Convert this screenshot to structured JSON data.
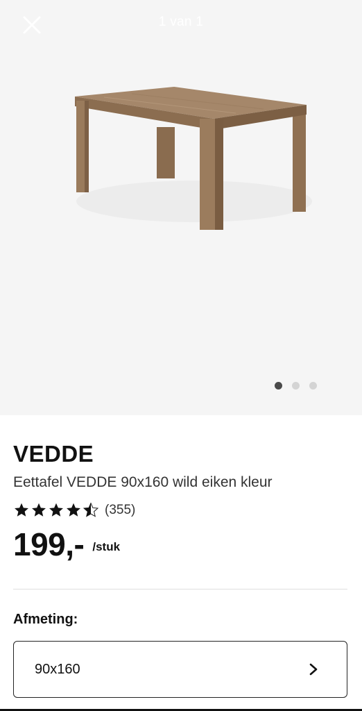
{
  "gallery": {
    "counter": "1 van 1",
    "close_icon": "close-icon",
    "image_alt": "VEDDE eettafel",
    "active_slide": 1,
    "slide_count": 3
  },
  "product": {
    "brand": "VEDDE",
    "description": "Eettafel VEDDE 90x160 wild eiken kleur",
    "rating": 4.5,
    "rating_max": 5,
    "review_count": "(355)",
    "price": "199,-",
    "price_unit": "/stuk"
  },
  "size": {
    "label": "Afmeting:",
    "value": "90x160",
    "chevron_icon": "chevron-right-icon"
  },
  "colors": {
    "gallery_bg": "#f5f5f5",
    "wood": "#9a7b5c",
    "text": "#111111"
  }
}
